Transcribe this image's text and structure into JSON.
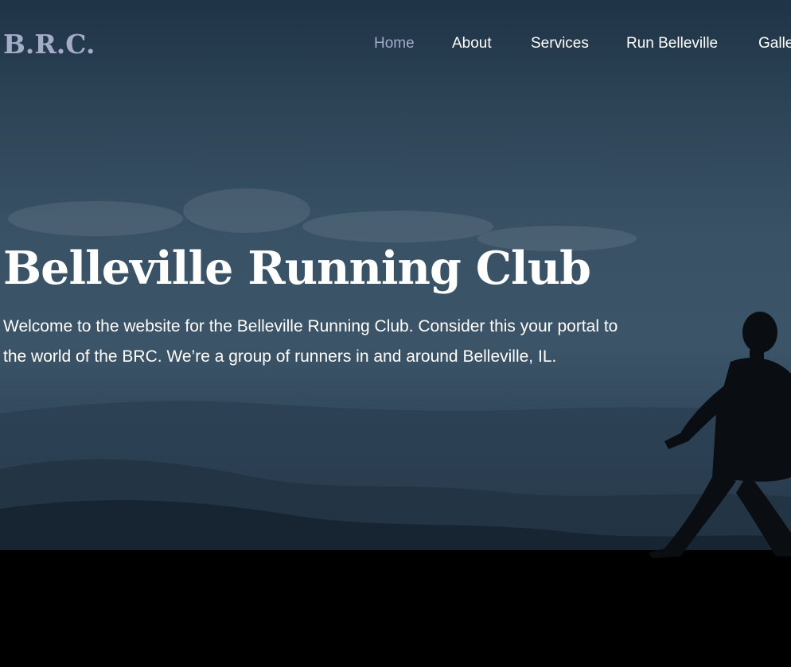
{
  "site": {
    "logo": "B.R.C."
  },
  "nav": {
    "items": [
      {
        "label": "Home",
        "active": true
      },
      {
        "label": "About",
        "active": false
      },
      {
        "label": "Services",
        "active": false
      },
      {
        "label": "Run Belleville",
        "active": false
      },
      {
        "label": "Gallery",
        "active": false
      }
    ]
  },
  "hero": {
    "title": "Belleville Running Club",
    "intro": "Welcome to the website for the Belleville Running Club. Consider this your portal to the world of the BRC. We’re a group of runners in and around Belleville, IL."
  },
  "colors": {
    "nav_active": "#a0aac6",
    "logo": "#a4acc8",
    "text": "#ffffff",
    "sky": "#3a5266"
  }
}
